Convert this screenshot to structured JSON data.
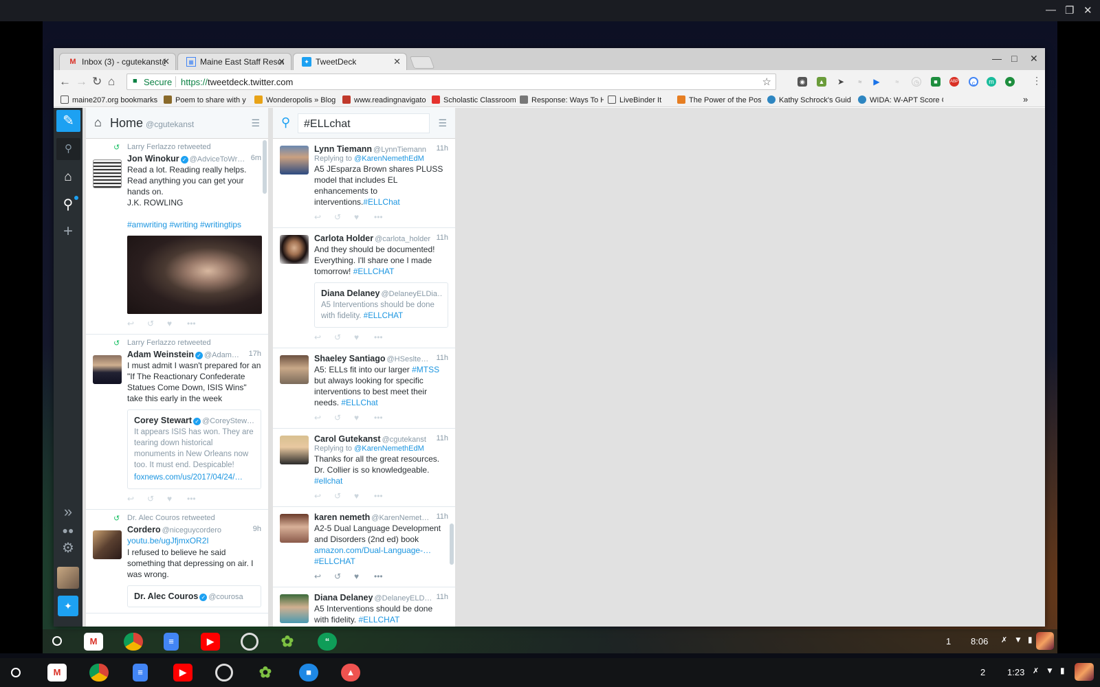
{
  "browser": {
    "tabs": [
      {
        "title": "Inbox (3) - cgutekanst@",
        "favicon": "gmail-icon",
        "active": false
      },
      {
        "title": "Maine East Staff Resour",
        "favicon": "docs-icon",
        "active": false
      },
      {
        "title": "TweetDeck",
        "favicon": "twitter-icon",
        "active": true
      }
    ],
    "security_label": "Secure",
    "url_scheme": "https://",
    "url_host": "tweetdeck.twitter.com",
    "bookmarks": [
      "maine207.org bookmarks",
      "Poem to share with y",
      "Wonderopolis » Blog",
      "www.readingnavigato",
      "Scholastic Classroom",
      "Response: Ways To H",
      "LiveBinder It",
      "The Power of the Pos",
      "Kathy Schrock's Guid",
      "WIDA: W-APT Score C"
    ],
    "bookmarks_more": "»",
    "ext_abp": "ABP"
  },
  "tweetdeck": {
    "col1": {
      "number": "1",
      "title": "Home",
      "handle": "@cgutekanst",
      "tweets": [
        {
          "retweeted_by": "Larry Ferlazzo retweeted",
          "name": "Jon Winokur",
          "handle": "@AdviceToWr…",
          "time": "6m",
          "text_lines": [
            "Read a lot. Reading really helps.",
            "Read anything you can get your",
            "hands on.",
            "J.K. ROWLING"
          ],
          "hashtags": "#amwriting #writing #writingtips"
        },
        {
          "retweeted_by": "Larry Ferlazzo retweeted",
          "name": "Adam Weinstein",
          "handle": "@Adam…",
          "time": "17h",
          "text": "I must admit I wasn't prepared for an \"If The Reactionary Confederate Statues Come Down, ISIS Wins\" take this early in the week",
          "quote": {
            "name": "Corey Stewart",
            "handle": "@CoreyStew…",
            "text": "It appears ISIS has won. They are tearing down historical monuments in New Orleans now too. It must end. Despicable!",
            "link": "foxnews.com/us/2017/04/24/…"
          }
        },
        {
          "retweeted_by": "Dr. Alec Couros retweeted",
          "name": "Cordero",
          "handle": "@niceguycordero",
          "time": "9h",
          "link": "youtu.be/ugJfjmxOR2I",
          "text": "I refused to believe he said something that depressing on air. I was wrong.",
          "quote_name": "Dr. Alec Couros",
          "quote_handle": "@courosa"
        }
      ]
    },
    "col2": {
      "number": "2",
      "search": "#ELLchat",
      "tweets": [
        {
          "name": "Lynn Tiemann",
          "handle": "@LynnTiemann",
          "time": "11h",
          "replying_prefix": "Replying to",
          "replying_to": "@KarenNemethEdM",
          "text": "A5 JEsparza Brown shares PLUSS model that includes EL enhancements to interventions.",
          "tag": "#ELLChat"
        },
        {
          "name": "Carlota Holder",
          "handle": "@carlota_holder",
          "time": "11h",
          "text": "And they should be documented! Everything. I'll share one I made tomorrow!",
          "tag": "#ELLCHAT",
          "quote": {
            "name": "Diana Delaney",
            "handle": "@DelaneyELDia…",
            "text": "A5 Interventions should be done with fidelity.",
            "tag": "#ELLCHAT"
          }
        },
        {
          "name": "Shaeley Santiago",
          "handle": "@HSeslte…",
          "time": "11h",
          "text_a": "A5: ELLs fit into our larger",
          "tag_a": "#MTSS",
          "text_b": "but always looking for specific interventions to best meet their needs.",
          "tag": "#ELLChat"
        },
        {
          "name": "Carol Gutekanst",
          "handle": "@cgutekanst",
          "time": "11h",
          "replying_prefix": "Replying to",
          "replying_to": "@KarenNemethEdM",
          "text": "Thanks for all the great resources. Dr. Collier is so knowledgeable.",
          "tag": "#ellchat"
        },
        {
          "name": "karen nemeth",
          "handle": "@KarenNemet…",
          "time": "11h",
          "text": "A2-5 Dual Language Development and Disorders (2nd ed) book",
          "link": "amazon.com/Dual-Language-…",
          "tag": "#ELLCHAT"
        },
        {
          "name": "Diana Delaney",
          "handle": "@DelaneyELD…",
          "time": "11h",
          "text": "A5 Interventions should be done with fidelity.",
          "tag": "#ELLCHAT"
        }
      ]
    }
  },
  "shelf_upper": {
    "desk_number": "1",
    "time": "8:06"
  },
  "shelf_lower": {
    "desk_number": "2",
    "time": "1:23"
  },
  "colors": {
    "twitter_blue": "#1da1f2",
    "link": "#1b95e0",
    "retweet_green": "#17bf63",
    "nav_dark": "#292f33"
  }
}
